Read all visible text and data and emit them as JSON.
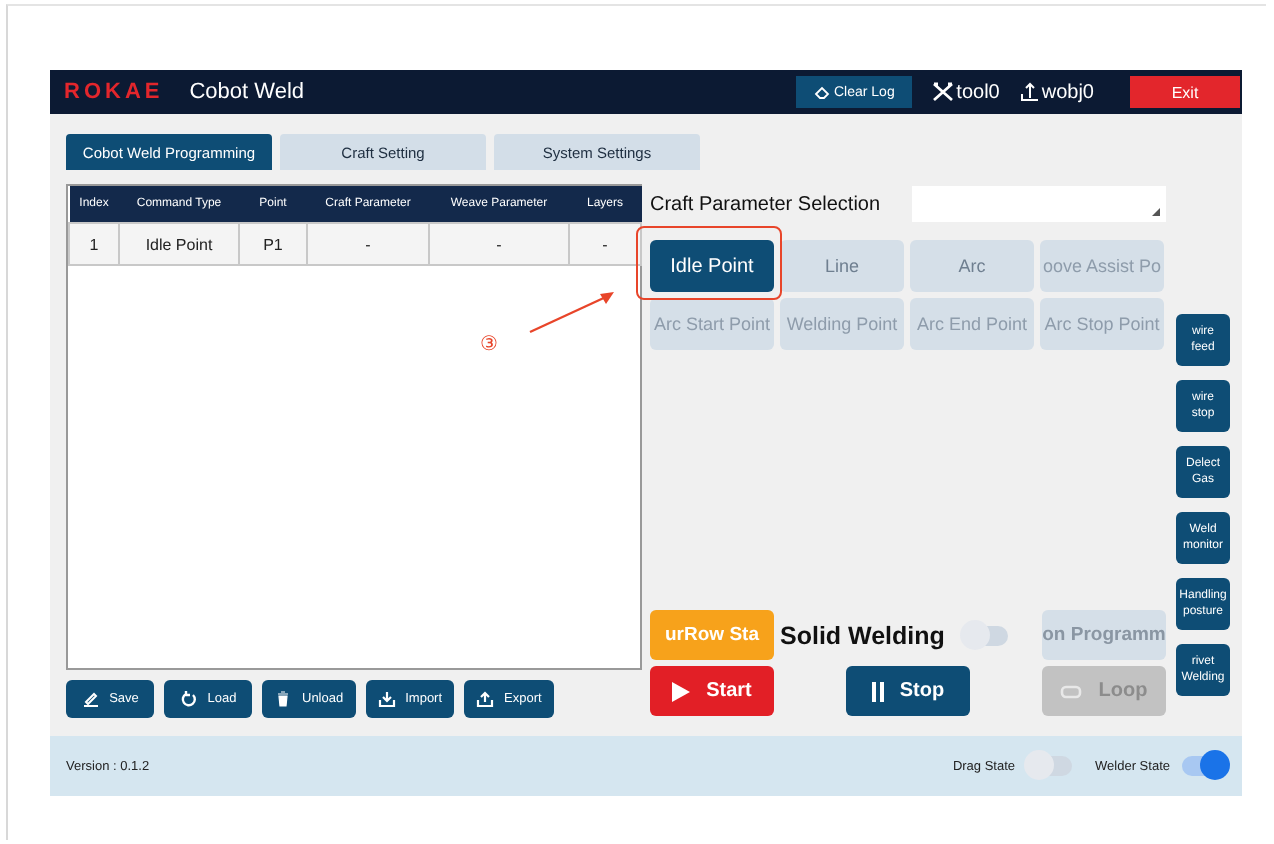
{
  "title_bar": {
    "logo": "ROKAE",
    "app_name": "Cobot Weld",
    "clear_log": "Clear Log",
    "tool": "tool0",
    "wobj": "wobj0",
    "exit": "Exit"
  },
  "tabs": [
    {
      "label": "Cobot Weld Programming",
      "selected": true
    },
    {
      "label": "Craft Setting",
      "selected": false
    },
    {
      "label": "System Settings",
      "selected": false
    }
  ],
  "table": {
    "columns": [
      "Index",
      "Command Type",
      "Point",
      "Craft Parameter",
      "Weave Parameter",
      "Layers"
    ],
    "rows": [
      [
        "1",
        "Idle Point",
        "P1",
        "-",
        "-",
        "-"
      ]
    ]
  },
  "file_buttons": [
    {
      "kind": "save",
      "label": "Save"
    },
    {
      "kind": "load",
      "label": "Load"
    },
    {
      "kind": "unload",
      "label": "Unload"
    },
    {
      "kind": "import",
      "label": "Import"
    },
    {
      "kind": "export",
      "label": "Export"
    }
  ],
  "craft_parameter_selection": {
    "label": "Craft Parameter Selection"
  },
  "point_buttons": [
    {
      "label": "Idle Point",
      "selected": true,
      "disabled": false
    },
    {
      "label": "Line",
      "selected": false,
      "disabled": false
    },
    {
      "label": "Arc",
      "selected": false,
      "disabled": false
    },
    {
      "label": "oove Assist Po",
      "selected": false,
      "disabled": true
    },
    {
      "label": "Arc Start Point",
      "selected": false,
      "disabled": true
    },
    {
      "label": "Welding Point",
      "selected": false,
      "disabled": true
    },
    {
      "label": "Arc End Point",
      "selected": false,
      "disabled": true
    },
    {
      "label": "Arc Stop Point",
      "selected": false,
      "disabled": true
    }
  ],
  "side_buttons": [
    "wire feed",
    "wire stop",
    "Delect Gas",
    "Weld monitor",
    "Handling posture",
    "rivet Welding"
  ],
  "current_row_start": "urRow Sta",
  "solid_welding": {
    "label": "Solid Welding",
    "on": false
  },
  "run_program": {
    "label": "on Programm",
    "disabled": true
  },
  "start": "Start",
  "stop": "Stop",
  "loop": {
    "label": "Loop",
    "disabled": true
  },
  "status_bar": {
    "version": "Version : 0.1.2",
    "toggles": [
      {
        "label": "Drag State",
        "on": false
      },
      {
        "label": "Welder State",
        "on": true
      }
    ]
  },
  "annotation": {
    "marker": "③"
  }
}
